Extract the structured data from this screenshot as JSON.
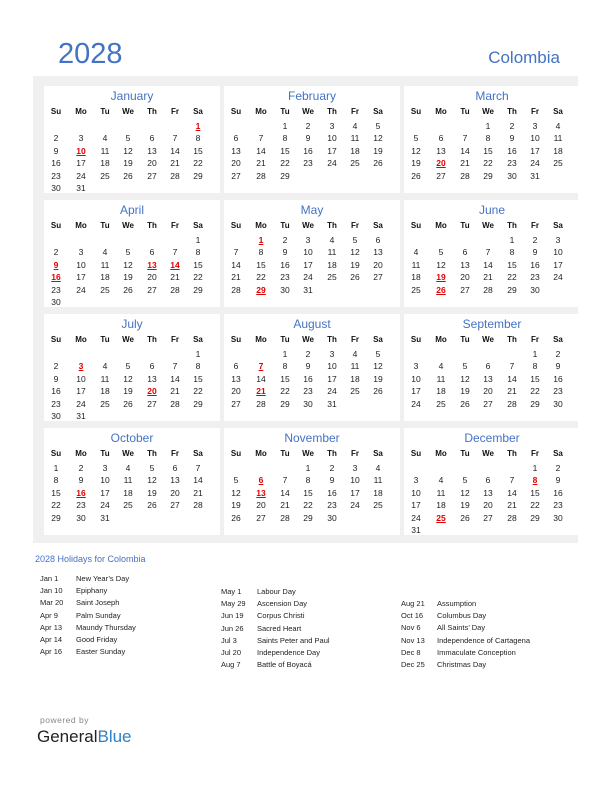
{
  "header": {
    "year": "2028",
    "country": "Colombia"
  },
  "weekdays": [
    "Su",
    "Mo",
    "Tu",
    "We",
    "Th",
    "Fr",
    "Sa"
  ],
  "months": [
    {
      "name": "January",
      "start": 6,
      "days": 31,
      "holidays": [
        1,
        10
      ]
    },
    {
      "name": "February",
      "start": 2,
      "days": 29,
      "holidays": []
    },
    {
      "name": "March",
      "start": 3,
      "days": 31,
      "holidays": [
        20
      ]
    },
    {
      "name": "April",
      "start": 6,
      "days": 30,
      "holidays": [
        9,
        13,
        14,
        16
      ]
    },
    {
      "name": "May",
      "start": 1,
      "days": 31,
      "holidays": [
        1,
        29
      ]
    },
    {
      "name": "June",
      "start": 4,
      "days": 30,
      "holidays": [
        19,
        26
      ]
    },
    {
      "name": "July",
      "start": 6,
      "days": 31,
      "holidays": [
        3,
        20
      ]
    },
    {
      "name": "August",
      "start": 2,
      "days": 31,
      "holidays": [
        7,
        21
      ]
    },
    {
      "name": "September",
      "start": 5,
      "days": 30,
      "holidays": []
    },
    {
      "name": "October",
      "start": 0,
      "days": 31,
      "holidays": [
        16
      ]
    },
    {
      "name": "November",
      "start": 3,
      "days": 30,
      "holidays": [
        6,
        13
      ]
    },
    {
      "name": "December",
      "start": 5,
      "days": 31,
      "holidays": [
        8,
        25
      ]
    }
  ],
  "holidays_title": "2028 Holidays for Colombia",
  "holidays": [
    [
      {
        "date": "Jan 1",
        "name": "New Year’s Day"
      },
      {
        "date": "Jan 10",
        "name": "Epiphany"
      },
      {
        "date": "Mar 20",
        "name": "Saint Joseph"
      },
      {
        "date": "Apr 9",
        "name": "Palm Sunday"
      },
      {
        "date": "Apr 13",
        "name": "Maundy Thursday"
      },
      {
        "date": "Apr 14",
        "name": "Good Friday"
      },
      {
        "date": "Apr 16",
        "name": "Easter Sunday"
      }
    ],
    [
      {
        "date": "May 1",
        "name": "Labour Day"
      },
      {
        "date": "May 29",
        "name": "Ascension Day"
      },
      {
        "date": "Jun 19",
        "name": "Corpus Christi"
      },
      {
        "date": "Jun 26",
        "name": "Sacred Heart"
      },
      {
        "date": "Jul 3",
        "name": "Saints Peter and Paul"
      },
      {
        "date": "Jul 20",
        "name": "Independence Day"
      },
      {
        "date": "Aug 7",
        "name": "Battle of Boyacá"
      }
    ],
    [
      {
        "date": "Aug 21",
        "name": "Assumption"
      },
      {
        "date": "Oct 16",
        "name": "Columbus Day"
      },
      {
        "date": "Nov 6",
        "name": "All Saints’ Day"
      },
      {
        "date": "Nov 13",
        "name": "Independence of Cartagena"
      },
      {
        "date": "Dec 8",
        "name": "Immaculate Conception"
      },
      {
        "date": "Dec 25",
        "name": "Christmas Day"
      }
    ]
  ],
  "footer": {
    "powered_by": "powered by",
    "brand_part1": "General",
    "brand_part2": "Blue"
  },
  "colors": {
    "accent": "#4472c4",
    "holiday": "#e00000",
    "panel_bg": "#f0f0f0"
  }
}
